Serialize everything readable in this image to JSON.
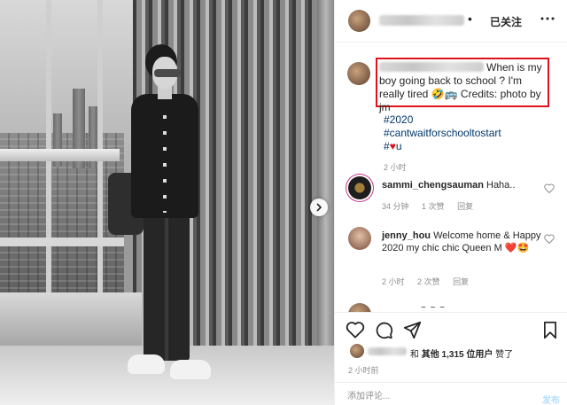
{
  "header": {
    "dot": "•",
    "follow_status": "已关注"
  },
  "caption": {
    "text": "When is my boy going back to school ? I'm really tired 🤣🚌 Credits: photo by jm",
    "hashtags": [
      "#2020",
      "#cantwaitforschooltostart"
    ],
    "hashtag3": "#",
    "heart": "♥",
    "hashtag3_rest": "u",
    "time": "2 小时"
  },
  "comments": [
    {
      "username": "sammi_chengsauman",
      "text": "Haha..",
      "time": "34 分钟",
      "likes": "1 次赞",
      "reply": "回复"
    },
    {
      "username": "jenny_hou",
      "text": "Welcome home & Happy 2020 my chic chic Queen M ❤️🤩",
      "time": "2 小时",
      "likes": "2 次赞",
      "reply": "回复"
    }
  ],
  "partial_row": "~ ~ ~",
  "likes": {
    "prefix": "和",
    "others_count": "其他 1,315 位用户",
    "suffix": "赞了"
  },
  "posted_time": "2 小时前",
  "add_comment": {
    "placeholder": "添加评论...",
    "post_label": "发布"
  },
  "icons": [
    "chevron-right-icon",
    "more-icon",
    "heart-outline-icon",
    "comment-icon",
    "share-icon",
    "bookmark-icon"
  ]
}
